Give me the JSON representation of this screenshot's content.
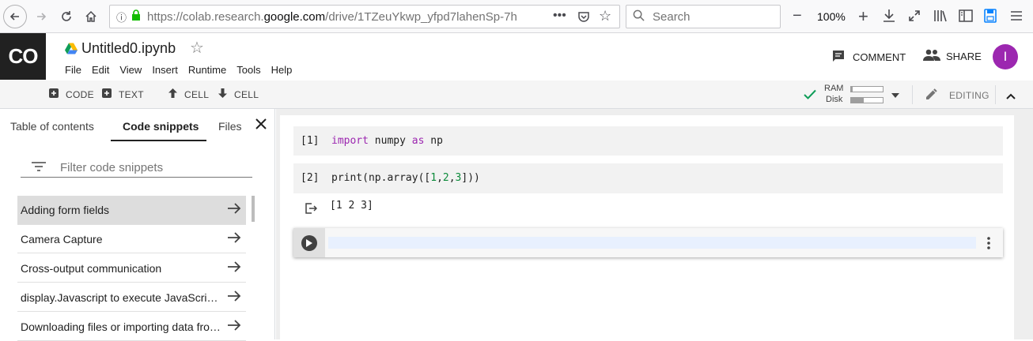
{
  "browser": {
    "url_prefix": "https://colab.research.",
    "url_domain": "google.com",
    "url_rest": "/drive/1TZeuYkwp_yfpd7lahenSp-7h",
    "search_placeholder": "Search",
    "zoom": "100%"
  },
  "header": {
    "logo": "CO",
    "notebook_title": "Untitled0.ipynb",
    "menu": [
      "File",
      "Edit",
      "View",
      "Insert",
      "Runtime",
      "Tools",
      "Help"
    ],
    "comment_label": "COMMENT",
    "share_label": "SHARE",
    "avatar_letter": "I"
  },
  "toolbar": {
    "code_label": "CODE",
    "text_label": "TEXT",
    "cell_up_label": "CELL",
    "cell_down_label": "CELL",
    "ram_label": "RAM",
    "disk_label": "Disk",
    "ram_usage": 0.05,
    "disk_usage": 0.4,
    "editing_label": "EDITING"
  },
  "sidebar": {
    "tabs": [
      "Table of contents",
      "Code snippets",
      "Files"
    ],
    "active_tab": "Code snippets",
    "filter_placeholder": "Filter code snippets",
    "snippets": [
      "Adding form fields",
      "Camera Capture",
      "Cross-output communication",
      "display.Javascript to execute JavaScript from Python",
      "Downloading files or importing data from Google Drive"
    ]
  },
  "cells": [
    {
      "count": "[1]",
      "code_kw1": "import",
      "code_mid": " numpy ",
      "code_kw2": "as",
      "code_end": " np"
    },
    {
      "count": "[2]",
      "code_start": "print(np.array([",
      "n1": "1",
      "n2": "2",
      "n3": "3",
      "code_end": "]))",
      "output": "[1 2 3]"
    }
  ],
  "colors": {
    "accent": "#9c27b0",
    "keyword": "#9c27b0",
    "number": "#0b8a3a",
    "check": "#0f9d58"
  }
}
